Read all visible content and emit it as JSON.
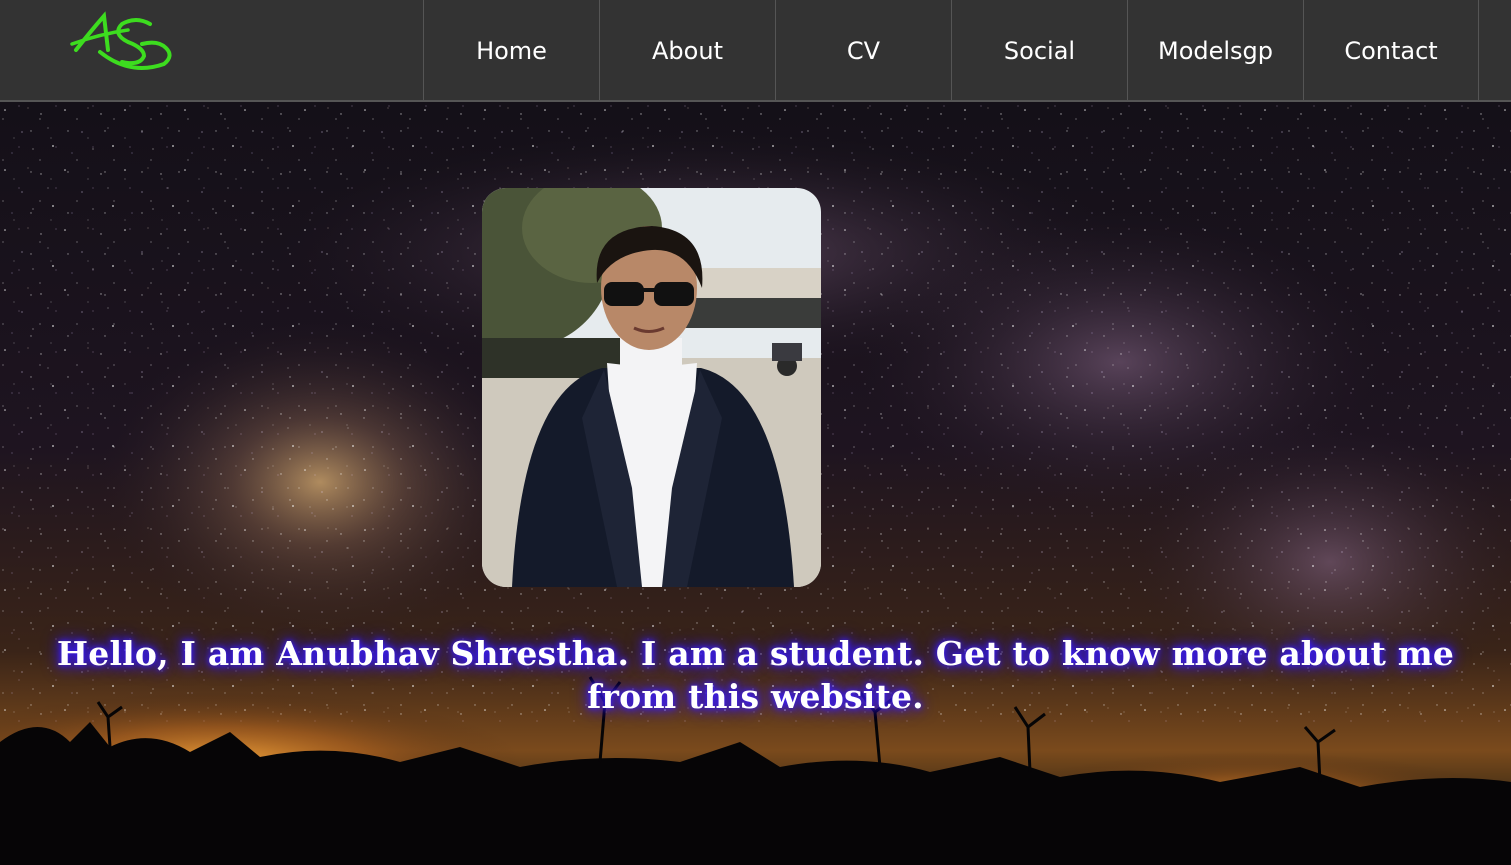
{
  "logo": {
    "text": "AS",
    "color": "#3ddc1f"
  },
  "nav": {
    "items": [
      {
        "label": "Home"
      },
      {
        "label": "About"
      },
      {
        "label": "CV"
      },
      {
        "label": "Social"
      },
      {
        "label": "Modelsgp"
      },
      {
        "label": "Contact"
      }
    ],
    "background": "#333333",
    "text_color": "#ffffff"
  },
  "hero": {
    "background": "night-sky-milky-way-image",
    "photo": "profile-photo-image",
    "intro_text": "Hello, I am Anubhav Shrestha. I am a student. Get to know more about me from this website.",
    "text_glow_color": "#3a1cff"
  }
}
